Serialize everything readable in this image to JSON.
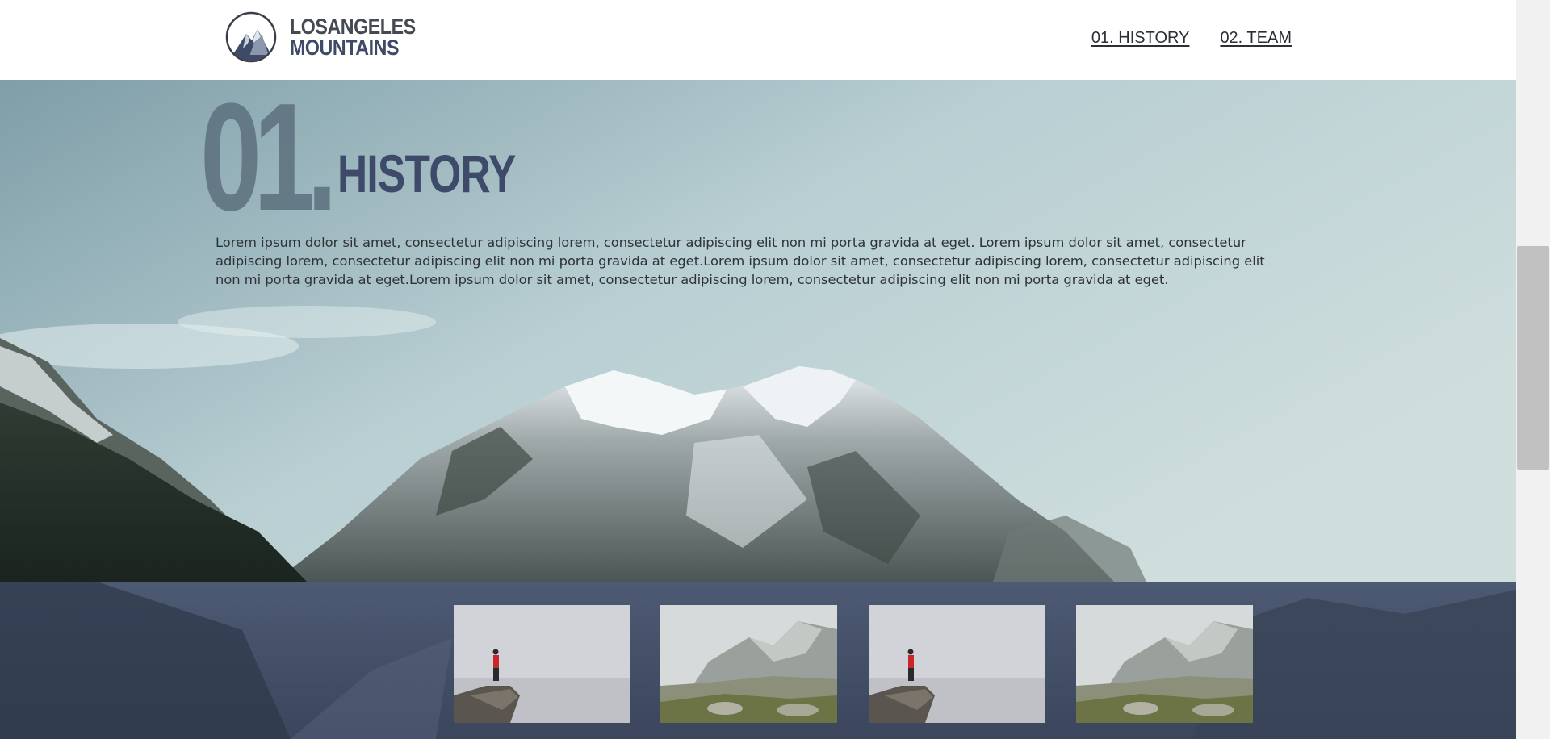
{
  "header": {
    "logo": {
      "line1": "LOSANGELES",
      "line2": "MOUNTAINS"
    },
    "nav": [
      {
        "label": "01. HISTORY"
      },
      {
        "label": "02. TEAM"
      }
    ]
  },
  "history": {
    "number": "01.",
    "title": "HISTORY",
    "body": "Lorem ipsum dolor sit amet, consectetur adipiscing lorem, consectetur adipiscing elit non mi porta gravida at eget. Lorem ipsum dolor sit amet, consectetur adipiscing lorem, consectetur adipiscing elit non mi porta gravida at eget.Lorem ipsum dolor sit amet, consectetur adipiscing lorem, consectetur adipiscing elit non mi porta gravida at eget.Lorem ipsum dolor sit amet, consectetur adipiscing lorem, consectetur adipiscing elit non mi porta gravida at eget."
  },
  "gallery": {
    "thumbnails": [
      {
        "icon": "hiker-on-rock-image"
      },
      {
        "icon": "misty-mountain-image"
      },
      {
        "icon": "hiker-on-rock-image"
      },
      {
        "icon": "misty-mountain-image"
      }
    ]
  },
  "colors": {
    "brand_navy": "#3e4a69",
    "gallery_bg": "#434f67",
    "number_gray": "#5f7480"
  }
}
